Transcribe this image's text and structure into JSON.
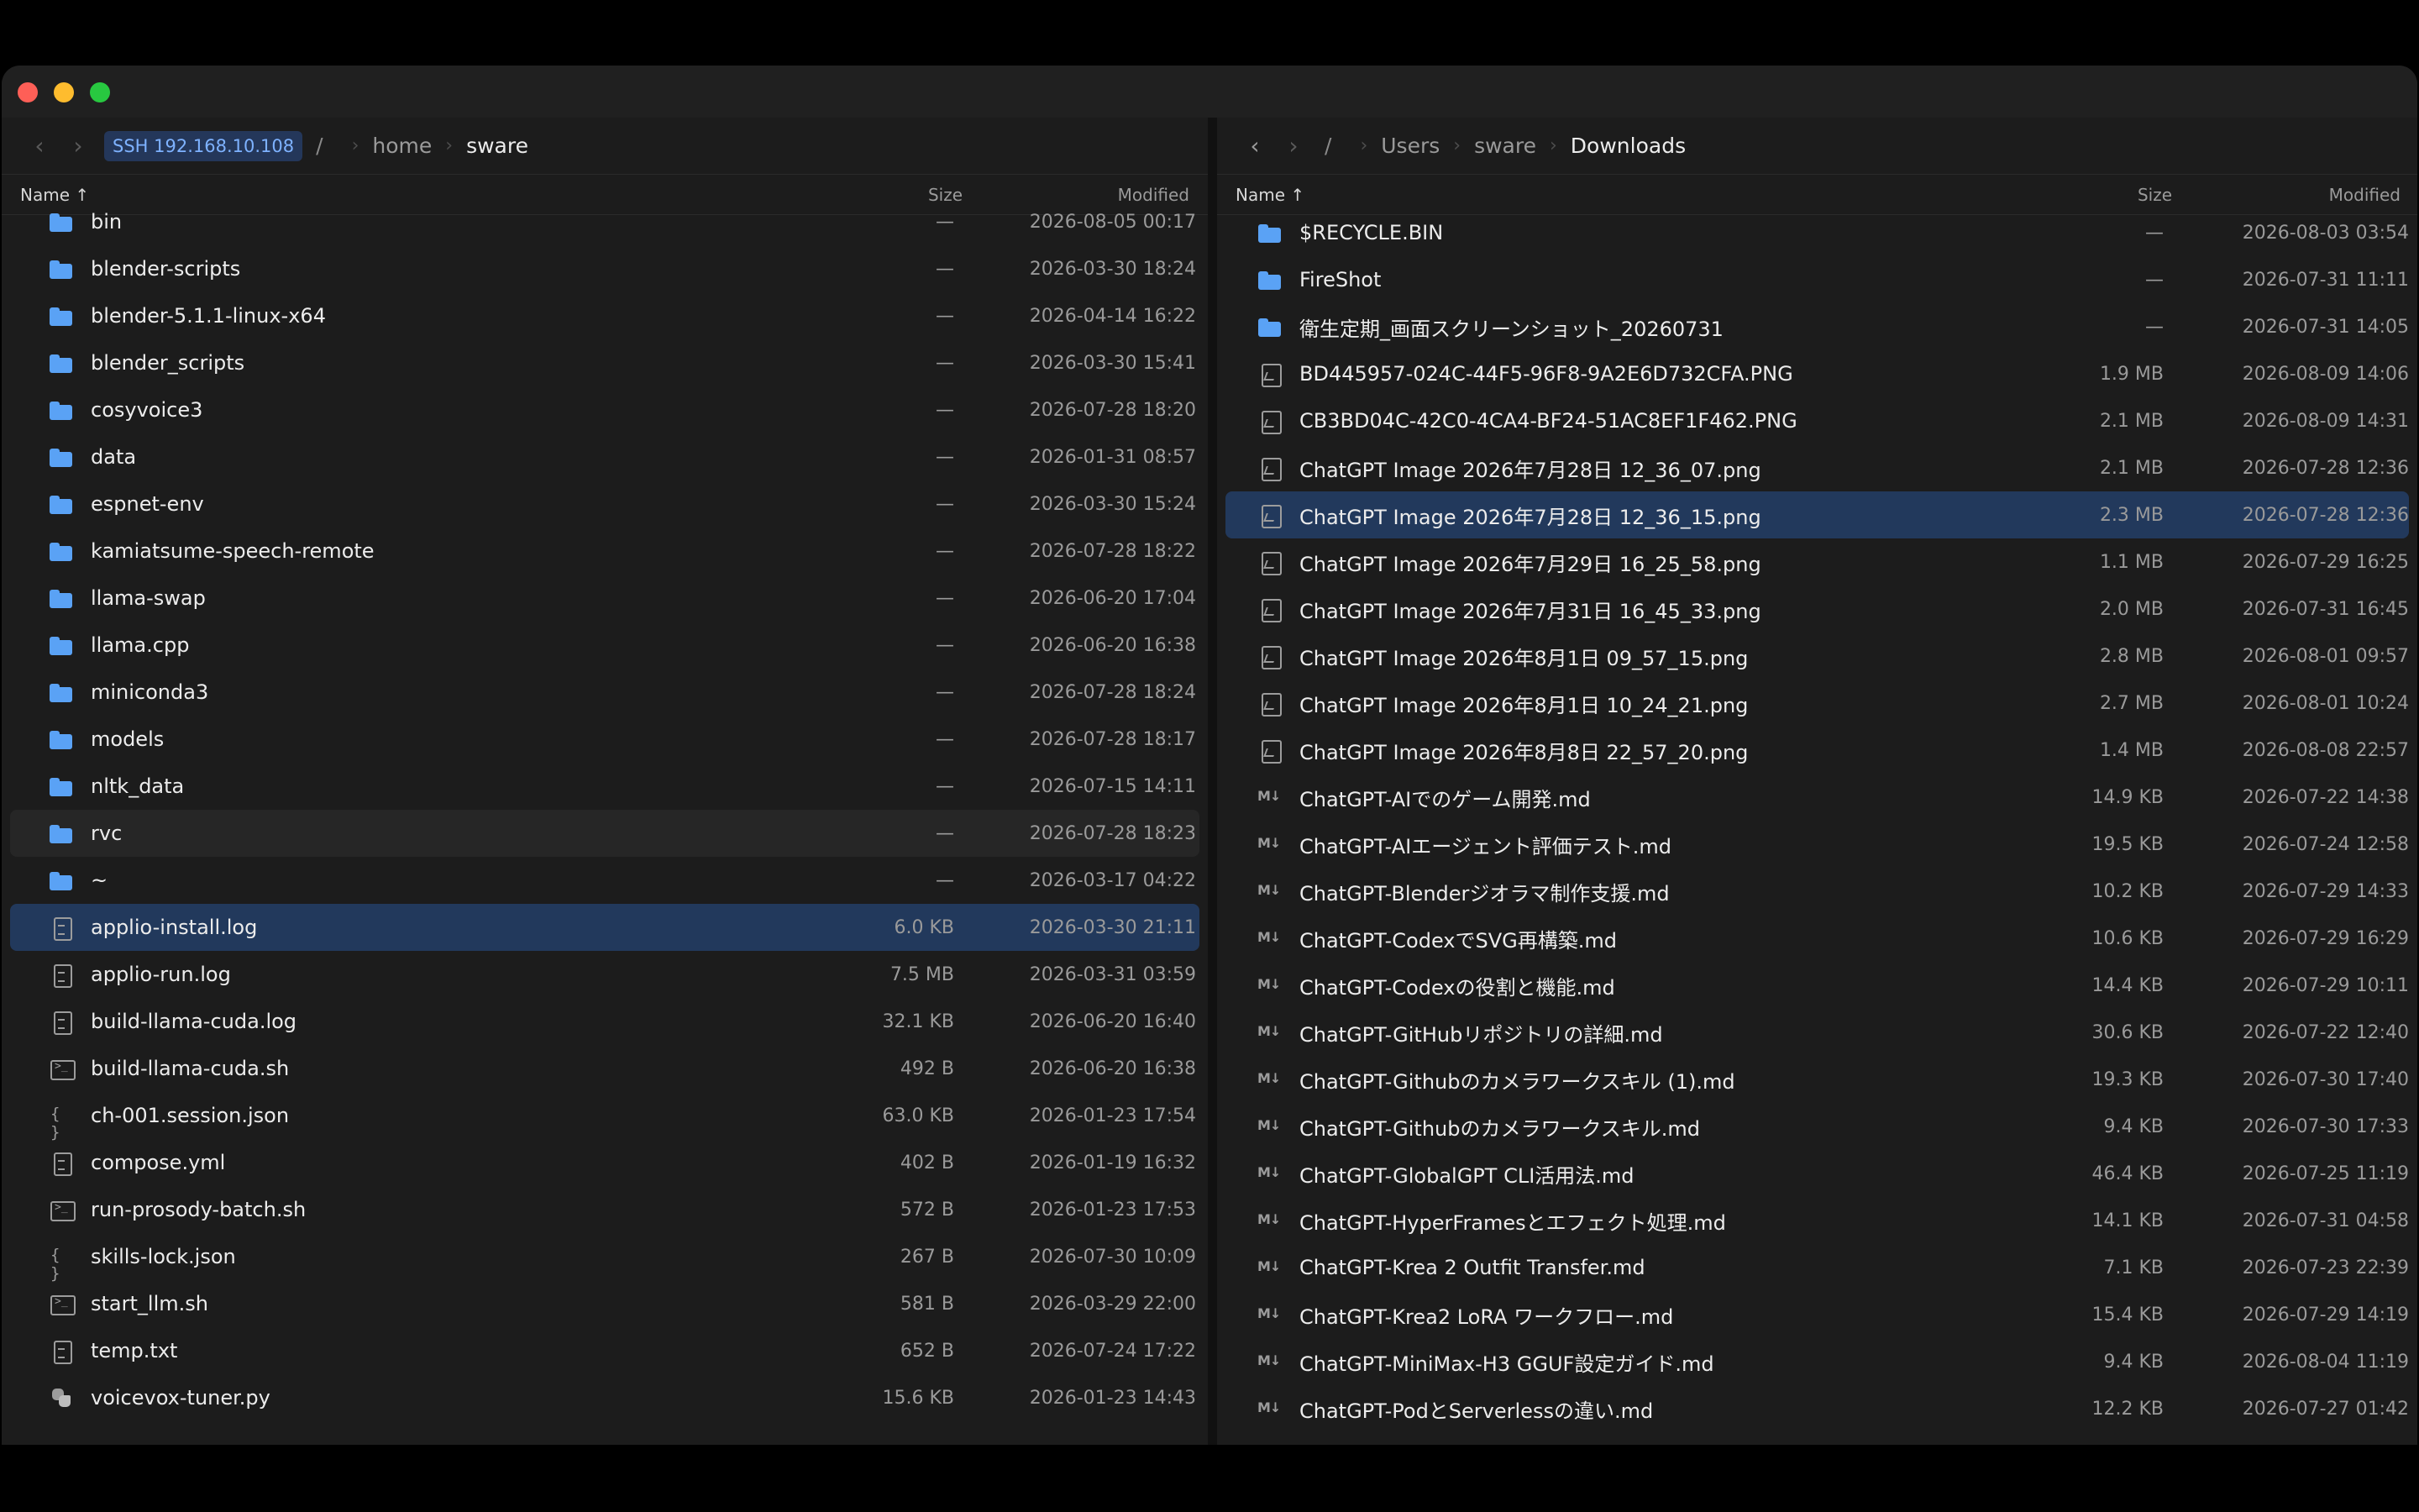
{
  "left": {
    "path": {
      "back": "‹",
      "forward": "›",
      "ssh": "SSH 192.168.10.108",
      "root": "/",
      "crumbs": [
        "home",
        "sware"
      ]
    },
    "header": {
      "name": "Name ↑",
      "size": "Size",
      "modified": "Modified"
    },
    "rows": [
      {
        "icon": "folder",
        "name": "bin",
        "size": "—",
        "modified": "2026-08-05 00:17"
      },
      {
        "icon": "folder",
        "name": "blender-scripts",
        "size": "—",
        "modified": "2026-03-30 18:24"
      },
      {
        "icon": "folder",
        "name": "blender-5.1.1-linux-x64",
        "size": "—",
        "modified": "2026-04-14 16:22"
      },
      {
        "icon": "folder",
        "name": "blender_scripts",
        "size": "—",
        "modified": "2026-03-30 15:41"
      },
      {
        "icon": "folder",
        "name": "cosyvoice3",
        "size": "—",
        "modified": "2026-07-28 18:20"
      },
      {
        "icon": "folder",
        "name": "data",
        "size": "—",
        "modified": "2026-01-31 08:57"
      },
      {
        "icon": "folder",
        "name": "espnet-env",
        "size": "—",
        "modified": "2026-03-30 15:24"
      },
      {
        "icon": "folder",
        "name": "kamiatsume-speech-remote",
        "size": "—",
        "modified": "2026-07-28 18:22"
      },
      {
        "icon": "folder",
        "name": "llama-swap",
        "size": "—",
        "modified": "2026-06-20 17:04"
      },
      {
        "icon": "folder",
        "name": "llama.cpp",
        "size": "—",
        "modified": "2026-06-20 16:38"
      },
      {
        "icon": "folder",
        "name": "miniconda3",
        "size": "—",
        "modified": "2026-07-28 18:24"
      },
      {
        "icon": "folder",
        "name": "models",
        "size": "—",
        "modified": "2026-07-28 18:17"
      },
      {
        "icon": "folder",
        "name": "nltk_data",
        "size": "—",
        "modified": "2026-07-15 14:11"
      },
      {
        "icon": "folder",
        "name": "rvc",
        "size": "—",
        "modified": "2026-07-28 18:23",
        "state": "hover"
      },
      {
        "icon": "folder",
        "name": "~",
        "size": "—",
        "modified": "2026-03-17 04:22"
      },
      {
        "icon": "doc",
        "name": "applio-install.log",
        "size": "6.0 KB",
        "modified": "2026-03-30 21:11",
        "state": "selected"
      },
      {
        "icon": "doc",
        "name": "applio-run.log",
        "size": "7.5 MB",
        "modified": "2026-03-31 03:59"
      },
      {
        "icon": "doc",
        "name": "build-llama-cuda.log",
        "size": "32.1 KB",
        "modified": "2026-06-20 16:40"
      },
      {
        "icon": "term",
        "name": "build-llama-cuda.sh",
        "size": "492 B",
        "modified": "2026-06-20 16:38"
      },
      {
        "icon": "json",
        "name": "ch-001.session.json",
        "size": "63.0 KB",
        "modified": "2026-01-23 17:54"
      },
      {
        "icon": "doc",
        "name": "compose.yml",
        "size": "402 B",
        "modified": "2026-01-19 16:32"
      },
      {
        "icon": "term",
        "name": "run-prosody-batch.sh",
        "size": "572 B",
        "modified": "2026-01-23 17:53"
      },
      {
        "icon": "json",
        "name": "skills-lock.json",
        "size": "267 B",
        "modified": "2026-07-30 10:09"
      },
      {
        "icon": "term",
        "name": "start_llm.sh",
        "size": "581 B",
        "modified": "2026-03-29 22:00"
      },
      {
        "icon": "doc",
        "name": "temp.txt",
        "size": "652 B",
        "modified": "2026-07-24 17:22"
      },
      {
        "icon": "py",
        "name": "voicevox-tuner.py",
        "size": "15.6 KB",
        "modified": "2026-01-23 14:43"
      }
    ]
  },
  "right": {
    "path": {
      "back": "‹",
      "forward": "›",
      "root": "/",
      "crumbs": [
        "Users",
        "sware",
        "Downloads"
      ]
    },
    "header": {
      "name": "Name ↑",
      "size": "Size",
      "modified": "Modified"
    },
    "rows": [
      {
        "icon": "folder",
        "name": "$RECYCLE.BIN",
        "size": "—",
        "modified": "2026-08-03 03:54"
      },
      {
        "icon": "folder",
        "name": "FireShot",
        "size": "—",
        "modified": "2026-07-31 11:11"
      },
      {
        "icon": "folder",
        "name": "衛生定期_画面スクリーンショット_20260731",
        "size": "—",
        "modified": "2026-07-31 14:05"
      },
      {
        "icon": "img",
        "name": "BD445957-024C-44F5-96F8-9A2E6D732CFA.PNG",
        "size": "1.9 MB",
        "modified": "2026-08-09 14:06"
      },
      {
        "icon": "img",
        "name": "CB3BD04C-42C0-4CA4-BF24-51AC8EF1F462.PNG",
        "size": "2.1 MB",
        "modified": "2026-08-09 14:31"
      },
      {
        "icon": "img",
        "name": "ChatGPT Image 2026年7月28日 12_36_07.png",
        "size": "2.1 MB",
        "modified": "2026-07-28 12:36"
      },
      {
        "icon": "img",
        "name": "ChatGPT Image 2026年7月28日 12_36_15.png",
        "size": "2.3 MB",
        "modified": "2026-07-28 12:36",
        "state": "selected"
      },
      {
        "icon": "img",
        "name": "ChatGPT Image 2026年7月29日 16_25_58.png",
        "size": "1.1 MB",
        "modified": "2026-07-29 16:25"
      },
      {
        "icon": "img",
        "name": "ChatGPT Image 2026年7月31日 16_45_33.png",
        "size": "2.0 MB",
        "modified": "2026-07-31 16:45"
      },
      {
        "icon": "img",
        "name": "ChatGPT Image 2026年8月1日 09_57_15.png",
        "size": "2.8 MB",
        "modified": "2026-08-01 09:57"
      },
      {
        "icon": "img",
        "name": "ChatGPT Image 2026年8月1日 10_24_21.png",
        "size": "2.7 MB",
        "modified": "2026-08-01 10:24"
      },
      {
        "icon": "img",
        "name": "ChatGPT Image 2026年8月8日 22_57_20.png",
        "size": "1.4 MB",
        "modified": "2026-08-08 22:57"
      },
      {
        "icon": "md",
        "name": "ChatGPT-AIでのゲーム開発.md",
        "size": "14.9 KB",
        "modified": "2026-07-22 14:38"
      },
      {
        "icon": "md",
        "name": "ChatGPT-AIエージェント評価テスト.md",
        "size": "19.5 KB",
        "modified": "2026-07-24 12:58"
      },
      {
        "icon": "md",
        "name": "ChatGPT-Blenderジオラマ制作支援.md",
        "size": "10.2 KB",
        "modified": "2026-07-29 14:33"
      },
      {
        "icon": "md",
        "name": "ChatGPT-CodexでSVG再構築.md",
        "size": "10.6 KB",
        "modified": "2026-07-29 16:29"
      },
      {
        "icon": "md",
        "name": "ChatGPT-Codexの役割と機能.md",
        "size": "14.4 KB",
        "modified": "2026-07-29 10:11"
      },
      {
        "icon": "md",
        "name": "ChatGPT-GitHubリポジトリの詳細.md",
        "size": "30.6 KB",
        "modified": "2026-07-22 12:40"
      },
      {
        "icon": "md",
        "name": "ChatGPT-Githubのカメラワークスキル (1).md",
        "size": "19.3 KB",
        "modified": "2026-07-30 17:40"
      },
      {
        "icon": "md",
        "name": "ChatGPT-Githubのカメラワークスキル.md",
        "size": "9.4 KB",
        "modified": "2026-07-30 17:33"
      },
      {
        "icon": "md",
        "name": "ChatGPT-GlobalGPT CLI活用法.md",
        "size": "46.4 KB",
        "modified": "2026-07-25 11:19"
      },
      {
        "icon": "md",
        "name": "ChatGPT-HyperFramesとエフェクト処理.md",
        "size": "14.1 KB",
        "modified": "2026-07-31 04:58"
      },
      {
        "icon": "md",
        "name": "ChatGPT-Krea 2 Outfit Transfer.md",
        "size": "7.1 KB",
        "modified": "2026-07-23 22:39"
      },
      {
        "icon": "md",
        "name": "ChatGPT-Krea2 LoRA ワークフロー.md",
        "size": "15.4 KB",
        "modified": "2026-07-29 14:19"
      },
      {
        "icon": "md",
        "name": "ChatGPT-MiniMax-H3 GGUF設定ガイド.md",
        "size": "9.4 KB",
        "modified": "2026-08-04 11:19"
      },
      {
        "icon": "md",
        "name": "ChatGPT-PodとServerlessの違い.md",
        "size": "12.2 KB",
        "modified": "2026-07-27 01:42"
      }
    ]
  }
}
